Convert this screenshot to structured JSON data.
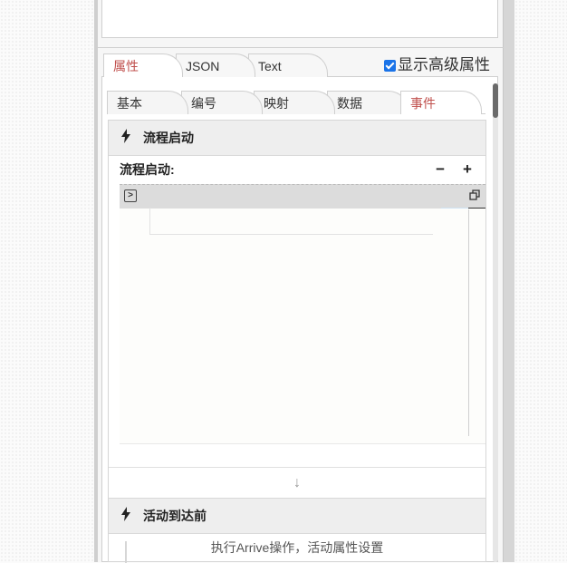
{
  "main_tabs": [
    {
      "label": "属性",
      "active": true
    },
    {
      "label": "JSON",
      "active": false
    },
    {
      "label": "Text",
      "active": false
    }
  ],
  "advanced_toggle": {
    "label": "显示高级属性",
    "checked": true
  },
  "sub_tabs": [
    {
      "label": "基本",
      "active": false
    },
    {
      "label": "编号",
      "active": false
    },
    {
      "label": "映射",
      "active": false
    },
    {
      "label": "数据",
      "active": false
    },
    {
      "label": "事件",
      "active": true
    }
  ],
  "event_sections": [
    {
      "title": "流程启动",
      "field_label": "流程启动:",
      "minus": "−",
      "plus": "+"
    },
    {
      "title": "活动到达前",
      "description": "执行Arrive操作，活动属性设置"
    }
  ],
  "icons": {
    "bolt": "lightning-icon",
    "run": "run-script-icon",
    "maximize": "maximize-icon",
    "down_arrow": "down-arrow-icon"
  },
  "colors": {
    "active_tab_text": "#c0504d",
    "checkbox": "#1a73e8"
  }
}
